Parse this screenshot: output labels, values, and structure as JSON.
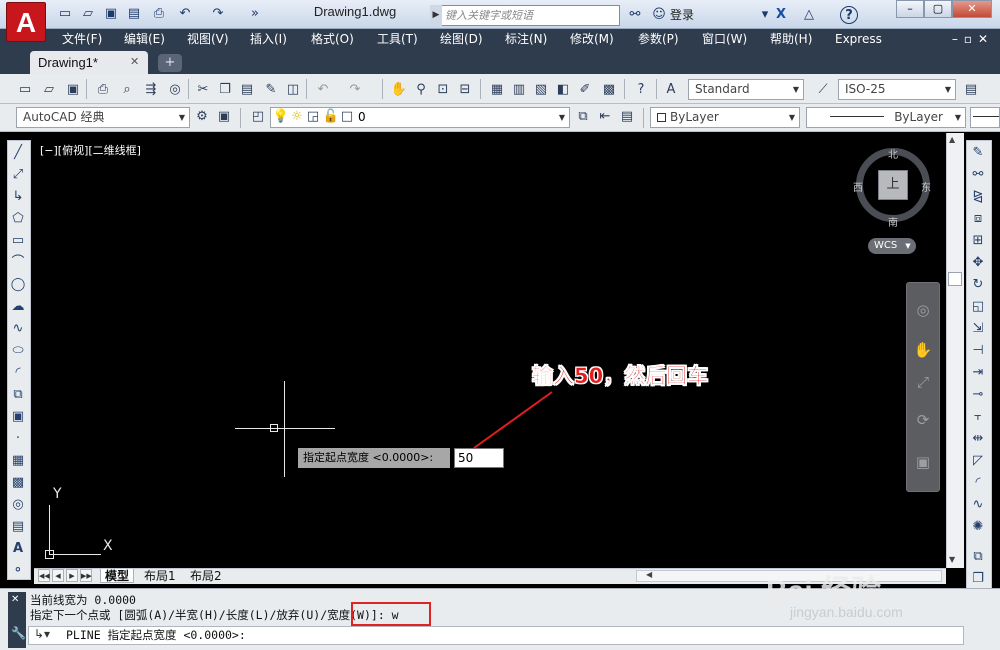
{
  "titlebar": {
    "doc_title": "Drawing1.dwg",
    "search_placeholder": "键入关键字或短语",
    "login": "登录",
    "app_logo": "A"
  },
  "menubar": {
    "items": [
      "文件(F)",
      "编辑(E)",
      "视图(V)",
      "插入(I)",
      "格式(O)",
      "工具(T)",
      "绘图(D)",
      "标注(N)",
      "修改(M)",
      "参数(P)",
      "窗口(W)",
      "帮助(H)",
      "Express"
    ]
  },
  "doc_tab": {
    "label": "Drawing1*"
  },
  "toolbar": {
    "text_style": "Standard",
    "dim_style": "ISO-25",
    "workspace": "AutoCAD 经典",
    "layer": "0",
    "color": "ByLayer",
    "linetype": "ByLayer"
  },
  "viewport": {
    "label": "[−][俯视][二维线框]"
  },
  "viewcube": {
    "north": "北",
    "south": "南",
    "east": "东",
    "west": "西",
    "top": "上",
    "wcs": "WCS"
  },
  "dynamic_input": {
    "prompt": "指定起点宽度 <0.0000>:",
    "value": "50"
  },
  "annotation": {
    "text": "输入50，然后回车"
  },
  "ucs": {
    "x": "X",
    "y": "Y"
  },
  "layout_tabs": [
    "模型",
    "布局1",
    "布局2"
  ],
  "command": {
    "history_line1": "当前线宽为 0.0000",
    "history_line2_a": "指定下一个点或 [圆弧(A)/半宽(H)/长度(L)/放弃(U)/",
    "history_line2_b": "宽度(W)]: w",
    "input": "PLINE 指定起点宽度 <0.0000>:"
  },
  "watermark": {
    "brand": "Bai 经验",
    "url": "jingyan.baidu.com"
  },
  "colors": {
    "menubar_bg": "#2f3c4e",
    "canvas_bg": "#000000",
    "annotation_red": "#e11e1e",
    "highlight_box": "#e02424"
  }
}
